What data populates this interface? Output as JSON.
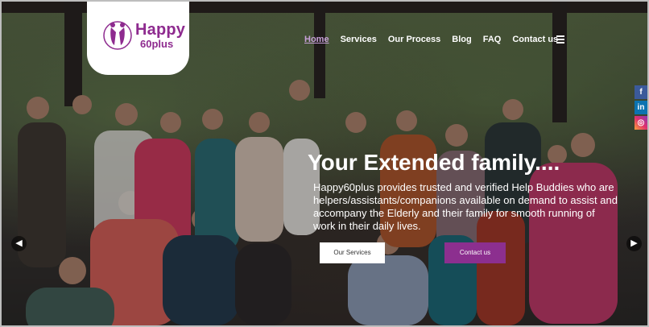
{
  "logo": {
    "line1": "Happy",
    "line2": "60plus"
  },
  "nav": {
    "items": [
      "Home",
      "Services",
      "Our Process",
      "Blog",
      "FAQ",
      "Contact us"
    ],
    "active": "Home"
  },
  "hero": {
    "headline": "Your Extended family....",
    "description": "Happy60plus provides trusted and verified Help Buddies who are helpers/assistants/companions available on demand to assist and accompany the Elderly and their family for smooth running of work in their daily lives."
  },
  "buttons": {
    "services": "Our Services",
    "contact": "Contact us"
  },
  "social": {
    "facebook": "f",
    "linkedin": "in",
    "instagram": "◎"
  },
  "arrows": {
    "prev": "◀",
    "next": "▶"
  },
  "colors": {
    "brand": "#8e2b8f",
    "button": "#8c2f8f",
    "nav_active": "#c7a0d8"
  }
}
